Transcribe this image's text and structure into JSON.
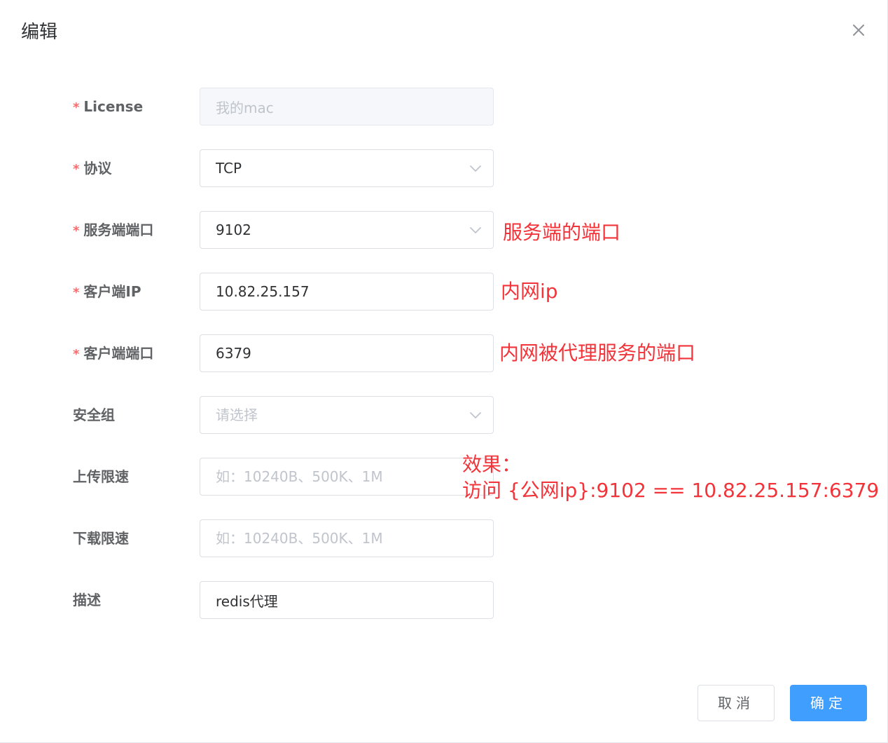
{
  "dialog": {
    "title": "编辑"
  },
  "form": {
    "license": {
      "label": "License",
      "value": "我的mac",
      "disabled": true
    },
    "protocol": {
      "label": "协议",
      "value": "TCP"
    },
    "server_port": {
      "label": "服务端端口",
      "value": "9102"
    },
    "client_ip": {
      "label": "客户端IP",
      "value": "10.82.25.157"
    },
    "client_port": {
      "label": "客户端端口",
      "value": "6379"
    },
    "security_group": {
      "label": "安全组",
      "placeholder": "请选择"
    },
    "upload_limit": {
      "label": "上传限速",
      "placeholder": "如：10240B、500K、1M"
    },
    "download_limit": {
      "label": "下载限速",
      "placeholder": "如：10240B、500K、1M"
    },
    "description": {
      "label": "描述",
      "value": "redis代理"
    }
  },
  "required_mark": "*",
  "annotations": {
    "server_port_note": "服务端的端口",
    "client_ip_note": "内网ip",
    "client_port_note": "内网被代理服务的端口",
    "effect_title": "效果：",
    "effect_detail": "访问 {公网ip}:9102 == 10.82.25.157:6379"
  },
  "footer": {
    "cancel_label": "取消",
    "ok_label": "确定"
  },
  "colors": {
    "primary": "#409eff",
    "required": "#f56c6c",
    "annotation": "#f2343a"
  },
  "icons": {
    "close": "close-icon",
    "select_arrow": "chevron-down-icon"
  }
}
